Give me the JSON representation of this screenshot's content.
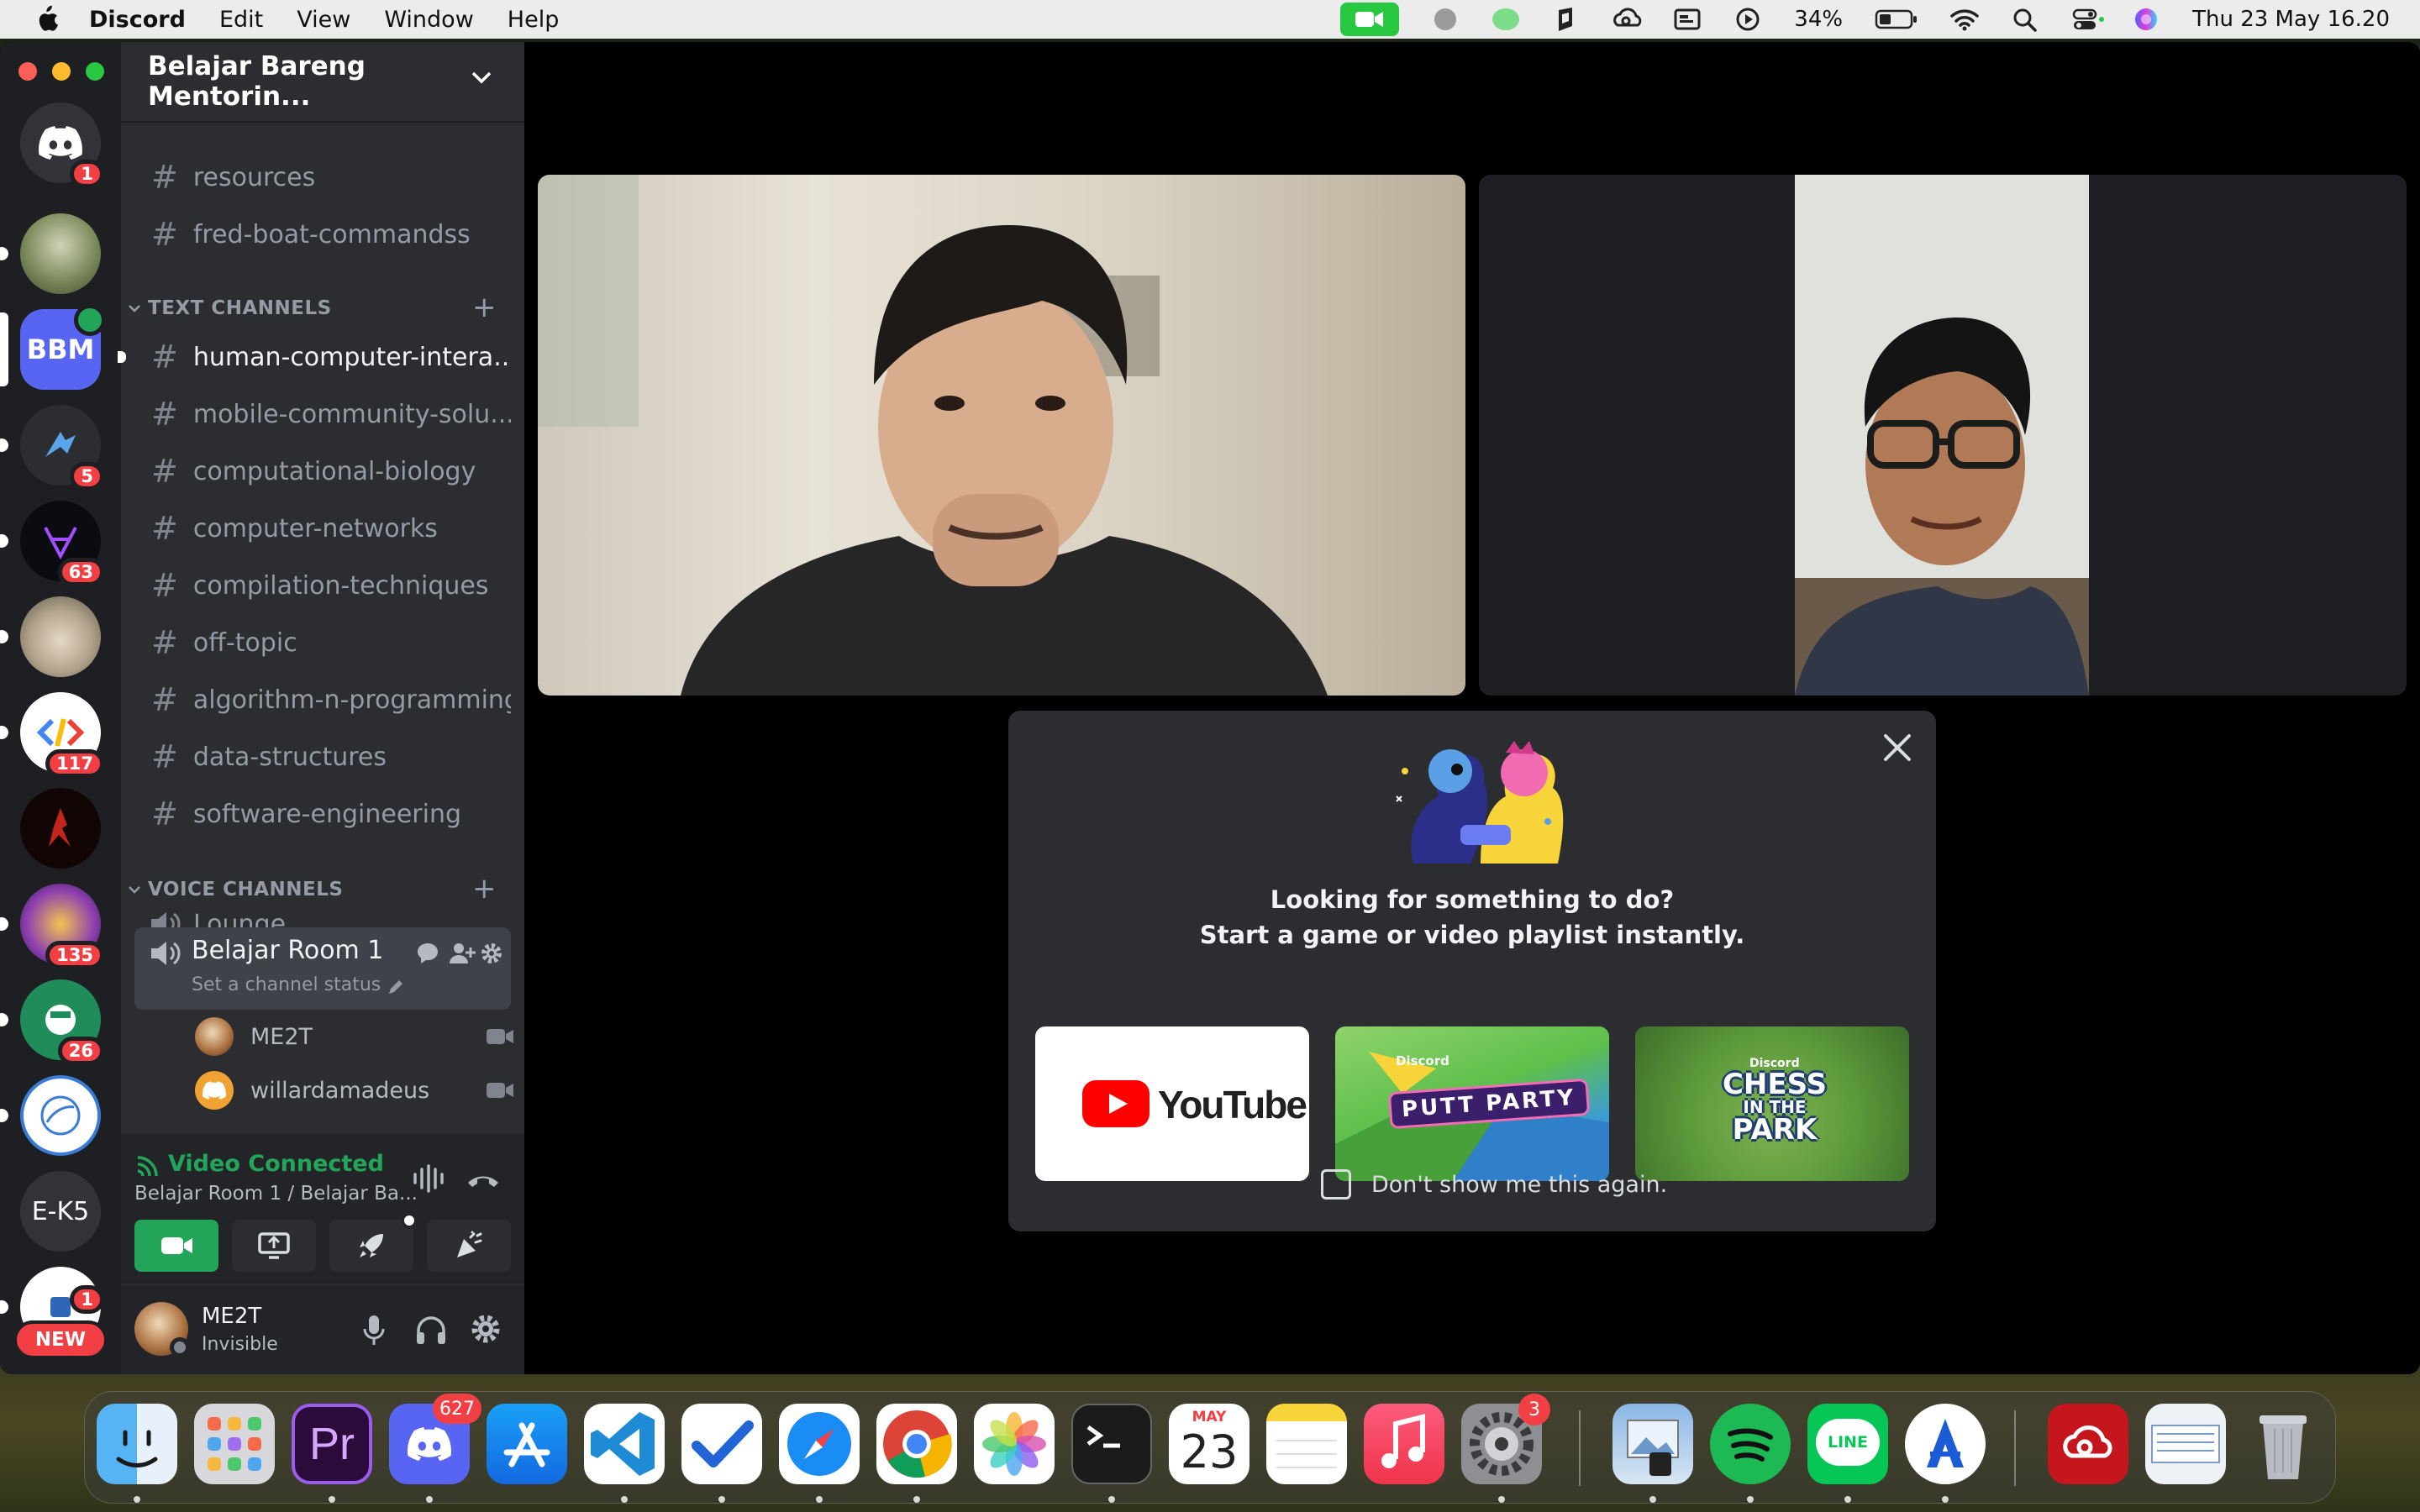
{
  "menubar": {
    "app_name": "Discord",
    "menus": [
      "Edit",
      "View",
      "Window",
      "Help"
    ],
    "battery": "34%",
    "datetime": "Thu 23 May  16.20"
  },
  "servers": {
    "home_badge": "1",
    "items": [
      {
        "label": "BBM"
      },
      {
        "badge": "5"
      },
      {
        "badge": "63"
      },
      {
        "badge": "117"
      },
      {
        "badge": "135"
      },
      {
        "badge": "26"
      },
      {
        "label": "E-K5"
      },
      {
        "badge": "1"
      }
    ],
    "new_label": "NEW"
  },
  "guild": {
    "name": "Belajar Bareng Mentorin...",
    "top_channels": [
      "resources",
      "fred-boat-commandss"
    ],
    "text_category": "TEXT CHANNELS",
    "text_channels": [
      "human-computer-intera...",
      "mobile-community-solu...",
      "computational-biology",
      "computer-networks",
      "compilation-techniques",
      "off-topic",
      "algorithm-n-programming",
      "data-structures",
      "software-engineering"
    ],
    "voice_category": "VOICE CHANNELS",
    "voice_channels": [
      "Lounge",
      "Belajar Room 1"
    ],
    "channel_status": "Set a channel status",
    "members": [
      "ME2T",
      "willardamadeus"
    ]
  },
  "voice_panel": {
    "status": "Video Connected",
    "location": "Belajar Room 1 / Belajar Ba..."
  },
  "user": {
    "name": "ME2T",
    "status": "Invisible"
  },
  "modal": {
    "line1": "Looking for something to do?",
    "line2": "Start a game or video playlist instantly.",
    "youtube_label": "YouTube",
    "putt_label": "PUTT PARTY",
    "chess_line1": "CHESS",
    "chess_line2": "IN THE",
    "chess_line3": "PARK",
    "discord_tag": "Discord",
    "dont_show": "Don't show me this again."
  },
  "dock": {
    "discord_badge": "627",
    "settings_badge": "3",
    "calendar_month": "MAY",
    "calendar_day": "23",
    "premiere_label": "Pr",
    "line_label": "LINE"
  },
  "colors": {
    "accent_green": "#23a559",
    "blurple": "#5865f2",
    "danger": "#f23f43"
  }
}
